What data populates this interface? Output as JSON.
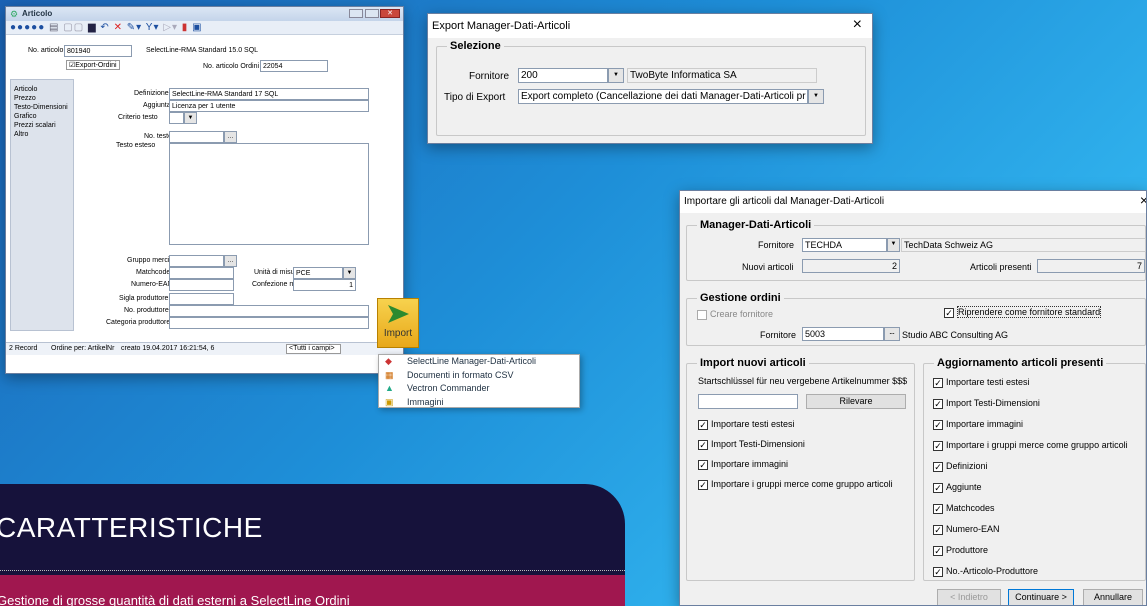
{
  "articolo": {
    "title": "Articolo",
    "no_articolo_label": "No. articolo",
    "no_articolo": "801940",
    "product_name": "SelectLine-RMA Standard 15.0 SQL",
    "export_ordini": "Export-Ordini",
    "no_ordini_label": "No. articolo Ordini",
    "no_ordini": "22054",
    "nav": [
      "Articolo",
      "Prezzo",
      "Testo-Dimensioni",
      "Grafico",
      "Prezzi scalari",
      "Altro"
    ],
    "definizione_label": "Definizione",
    "definizione": "SelectLine-RMA Standard 17 SQL",
    "aggiunta_label": "Aggiunta",
    "aggiunta": "Licenza per 1 utente",
    "criterio_label": "Criterio testo",
    "no_testo_label": "No. testo",
    "testo_esteso_label": "Testo esteso",
    "gruppo_merci_label": "Gruppo merci",
    "matchcode_label": "Matchcode",
    "numero_ean_label": "Numero-EAN",
    "unita_label": "Unità di misura",
    "unita": "PCE",
    "confezione_label": "Confezione minima",
    "confezione": "1",
    "sigla_label": "Sigla produttore",
    "no_produttore_label": "No. produttore",
    "categoria_label": "Categoria produttore",
    "status": [
      "2 Record",
      "Ordine per: ArtikelNr",
      "creato 19.04.2017 16:21:54, 6"
    ],
    "filter": "<Tutti i campi>"
  },
  "import_button": {
    "label": "Import"
  },
  "import_menu": [
    "SelectLine Manager-Dati-Articoli",
    "Documenti in formato CSV",
    "Vectron Commander",
    "Immagini"
  ],
  "export_dialog": {
    "title": "Export Manager-Dati-Articoli",
    "close": "×",
    "group": "Selezione",
    "fornitore_label": "Fornitore",
    "fornitore": "200",
    "fornitore_name": "TwoByte Informatica SA",
    "tipo_label": "Tipo di Export",
    "tipo": "Export completo (Cancellazione dei dati Manager-Dati-Articoli pr"
  },
  "import_dialog": {
    "title": "Importare gli articoli dal Manager-Dati-Articoli",
    "close": "×",
    "g1": "Manager-Dati-Articoli",
    "fornitore_label": "Fornitore",
    "fornitore": "TECHDA",
    "fornitore_name": "TechData Schweiz AG",
    "nuovi_label": "Nuovi articoli",
    "nuovi": "2",
    "presenti_label": "Articoli presenti",
    "presenti": "7",
    "g2": "Gestione ordini",
    "creare": "Creare fornitore",
    "riprendere": "Riprendere come fornitore standard",
    "fornitore2_label": "Fornitore",
    "fornitore2": "5003",
    "ellipsis": "...",
    "fornitore2_name": "Studio ABC Consulting AG",
    "g3": "Import nuovi articoli",
    "start_label": "Startschlüssel für neu vergebene Artikelnummer $$$",
    "rilevare": "Rilevare",
    "left_checks": [
      "Importare testi estesi",
      "Import Testi-Dimensioni",
      "Importare immagini",
      "Importare i gruppi merce come gruppo articoli"
    ],
    "g4": "Aggiornamento articoli presenti",
    "right_checks": [
      "Importare testi estesi",
      "Import Testi-Dimensioni",
      "Importare immagini",
      "Importare i gruppi merce come gruppo articoli",
      "Definizioni",
      "Aggiunte",
      "Matchcodes",
      "Numero-EAN",
      "Produttore",
      "No.-Articolo-Produttore"
    ],
    "indietro": "< Indietro",
    "continuare": "Continuare >",
    "annullare": "Annullare"
  },
  "banner": {
    "heading": "CARATTERISTICHE",
    "text": "Gestione di grosse quantità di dati esterni a SelectLine Ordini"
  }
}
